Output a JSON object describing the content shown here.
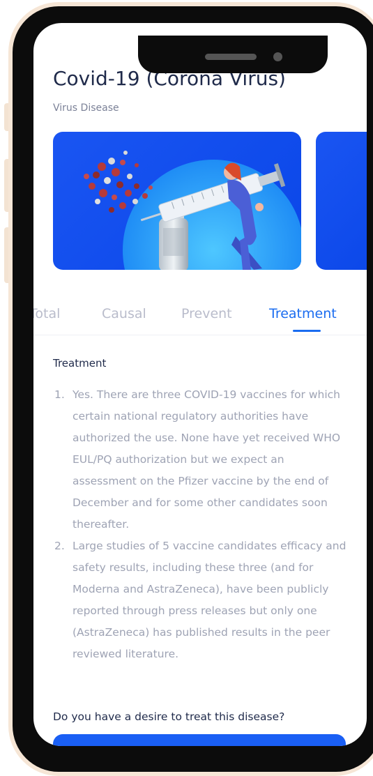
{
  "header": {
    "title": "Covid-19 (Corona Virus)",
    "subtitle": "Virus Disease"
  },
  "tabs": [
    {
      "label": "Total",
      "active": false
    },
    {
      "label": "Causal",
      "active": false
    },
    {
      "label": "Prevent",
      "active": false
    },
    {
      "label": "Treatment",
      "active": true
    }
  ],
  "section": {
    "heading": "Treatment",
    "items": [
      {
        "num": "1.",
        "text": "Yes. There are three COVID-19 vaccines for which certain national regulatory authorities have authorized the use. None have yet received WHO EUL/PQ authorization but we expect an assessment on the Pfizer vaccine by the end of December and for some other candidates soon thereafter."
      },
      {
        "num": "2.",
        "text": "Large studies of 5 vaccine candidates efficacy and safety results, including these three (and for Moderna and AstraZeneca), have been publicly reported  through press releases but only one (AstraZeneca) has published results in the peer reviewed literature."
      }
    ]
  },
  "cta": {
    "question": "Do you have a desire to treat this disease?",
    "button_label": ""
  },
  "colors": {
    "accent": "#1a6cf0",
    "card": "#0a46e8",
    "title": "#1f2a4a",
    "muted": "#9ea3b4",
    "frame": "#f6e6d6"
  },
  "icons": [
    "syringe-illustration",
    "vaccine-vial",
    "virus-cluster"
  ]
}
